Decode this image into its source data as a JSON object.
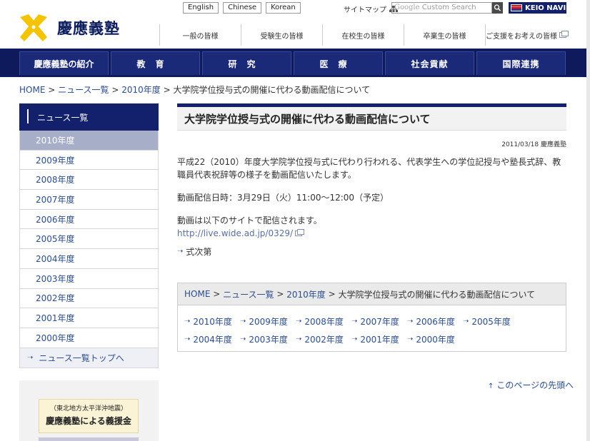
{
  "header": {
    "logo_text": "慶應義塾",
    "languages": [
      "English",
      "Chinese",
      "Korean"
    ],
    "sitemap_label": "サイトマップ",
    "search_placeholder_brand": "Google",
    "search_placeholder": "Custom Search",
    "keio_navi_label": "KEIO NAVI",
    "subnav": [
      "一般の皆様",
      "受験生の皆様",
      "在校生の皆様",
      "卒業生の皆様",
      "ご支援をお考えの皆様"
    ]
  },
  "global_nav": [
    "慶應義塾の紹介",
    "教育",
    "研究",
    "医療",
    "社会貢献",
    "国際連携"
  ],
  "breadcrumb": {
    "home": "HOME",
    "sep": ">",
    "news_list": "ニュース一覧",
    "year": "2010年度",
    "current": "大学院学位授与式の開催に代わる動画配信について"
  },
  "sidebar": {
    "heading": "ニュース一覧",
    "items": [
      "2010年度",
      "2009年度",
      "2008年度",
      "2007年度",
      "2006年度",
      "2005年度",
      "2004年度",
      "2003年度",
      "2002年度",
      "2001年度",
      "2000年度"
    ],
    "active_index": 0,
    "top_link": "ニュース一覧トップへ"
  },
  "banner": {
    "line1": "（東北地方太平洋沖地震）",
    "line2": "慶應義塾による義援金"
  },
  "article": {
    "title": "大学院学位授与式の開催に代わる動画配信について",
    "date": "2011/03/18",
    "author": "慶應義塾",
    "para1": "平成22（2010）年度大学院学位授与式に代わり行われる、代表学生への学位記授与や塾長式辞、教職員代表祝辞等の様子を動画配信いたします。",
    "para2": "動画配信日時：3月29日（火）11:00〜12:00（予定）",
    "para3": "動画は以下のサイトで配信されます。",
    "url": "http://live.wide.ad.jp/0329/",
    "link_program": "式次第"
  },
  "bottom": {
    "years": [
      "2010年度",
      "2009年度",
      "2008年度",
      "2007年度",
      "2006年度",
      "2005年度",
      "2004年度",
      "2003年度",
      "2002年度",
      "2001年度",
      "2000年度"
    ]
  },
  "page_top": "このページの先頭へ",
  "colors": {
    "navy": "#0e1a5c",
    "link": "#2d4d8c",
    "logo_yellow": "#f5c400"
  }
}
